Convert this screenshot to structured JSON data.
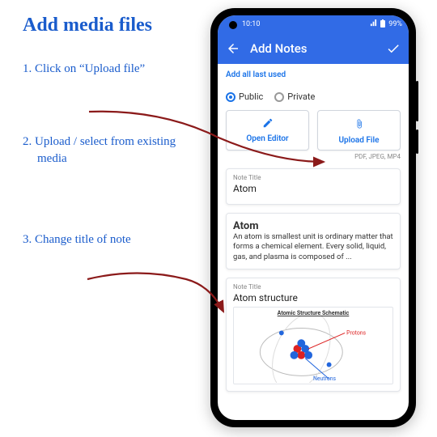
{
  "tutorial": {
    "heading": "Add media files",
    "steps": [
      "1.  Click on “Upload file”",
      "2.  Upload / select from existing media",
      "3.  Change title of note"
    ]
  },
  "status": {
    "time": "10:10",
    "battery": "99%"
  },
  "header": {
    "title": "Add Notes"
  },
  "links": {
    "add_all_last_used": "Add all last used"
  },
  "visibility": {
    "public": "Public",
    "private": "Private",
    "selected": "public"
  },
  "actions": {
    "open_editor": "Open Editor",
    "upload_file": "Upload File",
    "upload_hint": "PDF, JPEG, MP4"
  },
  "note1": {
    "label": "Note Title",
    "title": "Atom",
    "desc_title": "Atom",
    "desc_body": "An atom is smallest unit is ordinary matter that forms a chemical element. Every solid, liquid, gas, and plasma is composed of ..."
  },
  "note2": {
    "label": "Note Title",
    "title": "Atom structure",
    "chart_heading": "Atomic Structure Schematic",
    "chart_labels": {
      "protons": "Protons",
      "neutrons": "Neutrons"
    }
  },
  "colors": {
    "accent": "#1a5ccc",
    "primary": "#316be6",
    "link": "#1a73e8",
    "arrow": "#8b1a1a"
  }
}
